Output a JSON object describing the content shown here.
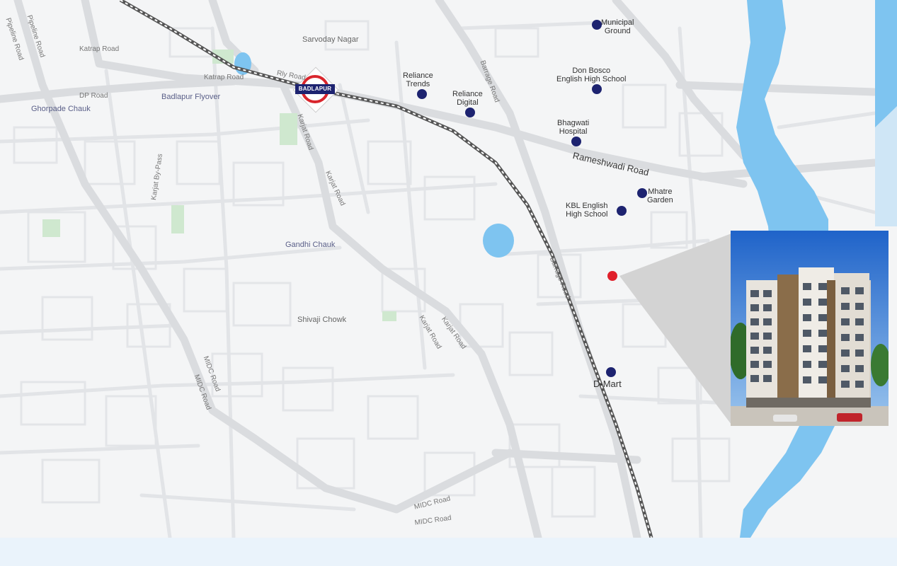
{
  "map": {
    "station_label": "BADLAPUR",
    "area_labels": [
      {
        "id": "sarvoday",
        "text": "Sarvoday Nagar"
      },
      {
        "id": "badlapur-flyover",
        "text": "Badlapur Flyover"
      },
      {
        "id": "ghorpade",
        "text": "Ghorpade Chauk"
      },
      {
        "id": "gandhi",
        "text": "Gandhi Chauk"
      },
      {
        "id": "shivaji",
        "text": "Shivaji Chowk"
      }
    ],
    "road_labels": [
      {
        "id": "pipeline-road-1",
        "text": "Pipeline Road"
      },
      {
        "id": "pipeline-road-2",
        "text": "Pipeline Road"
      },
      {
        "id": "katrap-road-1",
        "text": "Katrap Road"
      },
      {
        "id": "katrap-road-2",
        "text": "Katrap Road"
      },
      {
        "id": "dp-road",
        "text": "DP Road"
      },
      {
        "id": "karjat-bypass",
        "text": "Karjat By-Pass"
      },
      {
        "id": "karjat-road-1",
        "text": "Karjat Road"
      },
      {
        "id": "karjat-road-2",
        "text": "Karjat Road"
      },
      {
        "id": "karjat-road-3",
        "text": "Karjat Road"
      },
      {
        "id": "karjat-road-4",
        "text": "Karjat Road"
      },
      {
        "id": "barrage-road-1",
        "text": "Barrage Road"
      },
      {
        "id": "barrage-road-2",
        "text": "Barrage Road"
      },
      {
        "id": "rameshwadi-road",
        "text": "Rameshwadi Road"
      },
      {
        "id": "midc-road-1",
        "text": "MIDC Road"
      },
      {
        "id": "midc-road-2",
        "text": "MIDC Road"
      },
      {
        "id": "midc-road-3",
        "text": "MIDC Road"
      },
      {
        "id": "midc-road-4",
        "text": "MIDC Road"
      },
      {
        "id": "rly-road",
        "text": "Rly Road"
      }
    ],
    "poi_labels": [
      {
        "id": "municipal",
        "text": "Municipal\nGround"
      },
      {
        "id": "donbosco",
        "text": "Don Bosco\nEnglish High School"
      },
      {
        "id": "reliance-trends",
        "text": "Reliance\nTrends"
      },
      {
        "id": "reliance-digital",
        "text": "Reliance\nDigital"
      },
      {
        "id": "bhagwati",
        "text": "Bhagwati\nHospital"
      },
      {
        "id": "mhatre",
        "text": "Mhatre\nGarden"
      },
      {
        "id": "kbl",
        "text": "KBL English\nHigh School"
      },
      {
        "id": "dmart",
        "text": "D-Mart"
      }
    ]
  },
  "colors": {
    "poi": "#1d2370",
    "site_marker": "#e0202b",
    "water": "#7ec4f0",
    "land": "#f4f5f6",
    "road": "#dadcdf",
    "railway": "#555555"
  }
}
